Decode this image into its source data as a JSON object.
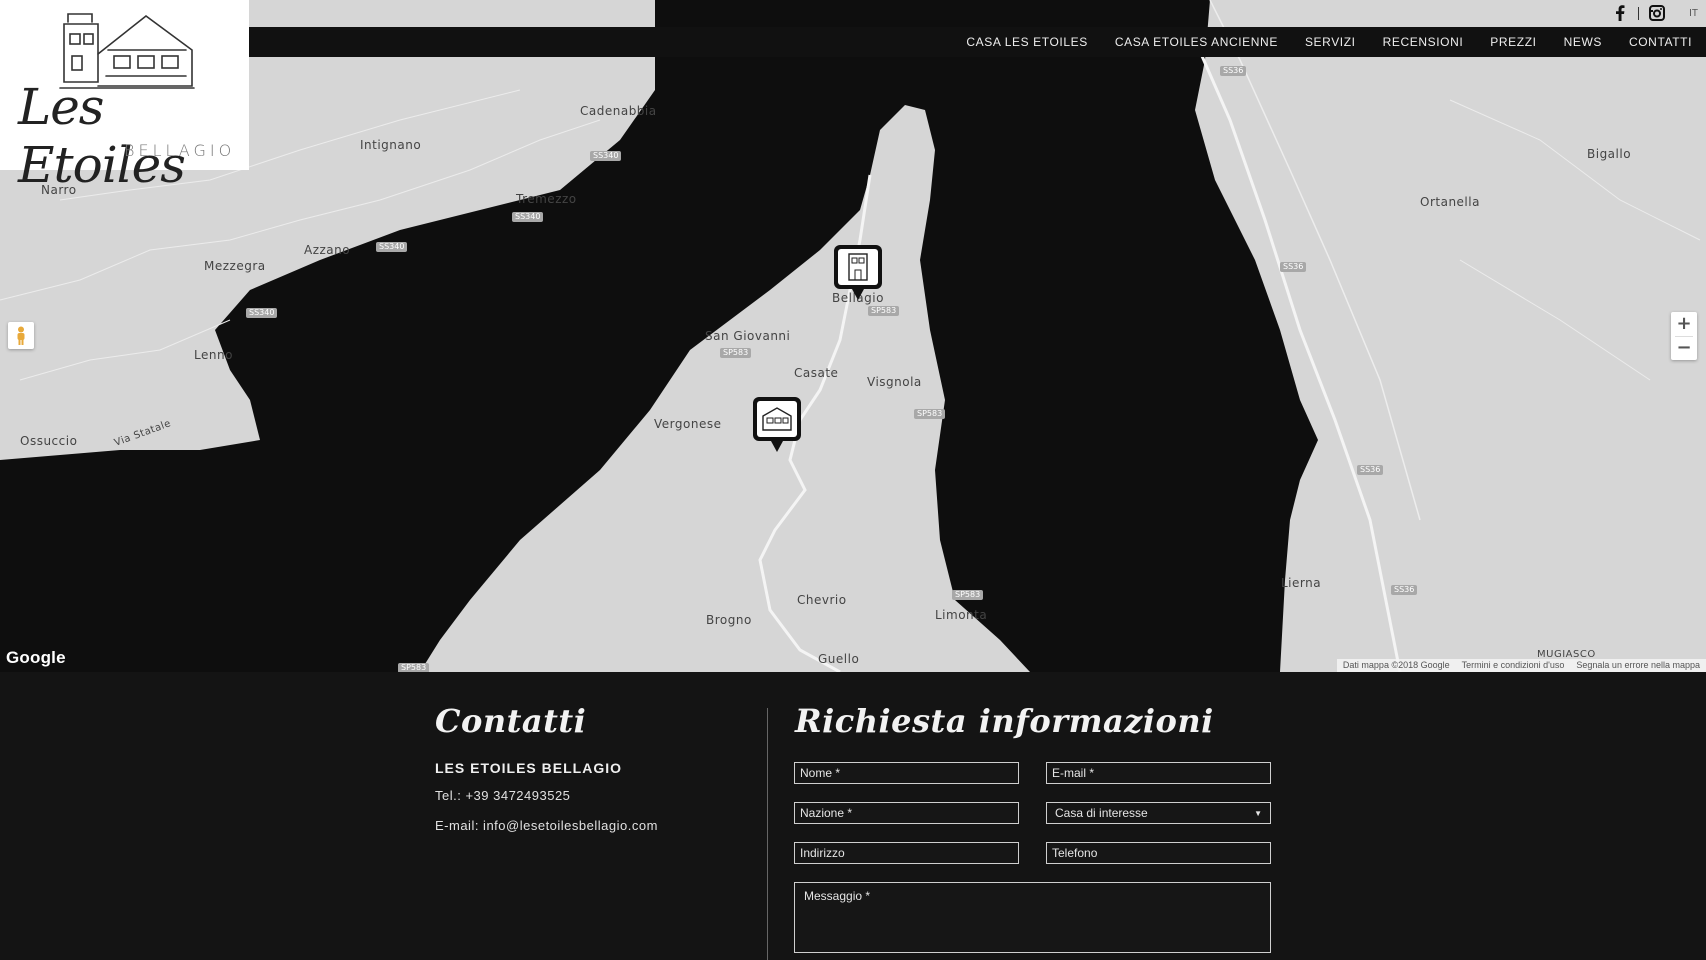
{
  "logo": {
    "script": "Les Etoiles",
    "subtitle": "BELLAGIO"
  },
  "nav": {
    "items": [
      {
        "label": "CASA LES ETOILES"
      },
      {
        "label": "CASA ETOILES ANCIENNE"
      },
      {
        "label": "SERVIZI"
      },
      {
        "label": "RECENSIONI"
      },
      {
        "label": "PREZZI"
      },
      {
        "label": "NEWS"
      },
      {
        "label": "CONTATTI"
      }
    ]
  },
  "social": {
    "facebook_icon": "facebook-icon",
    "instagram_icon": "instagram-icon",
    "language": "IT"
  },
  "map": {
    "places": [
      {
        "name": "Cadenabbia"
      },
      {
        "name": "Intignano"
      },
      {
        "name": "Narro"
      },
      {
        "name": "Tremezzo"
      },
      {
        "name": "Mezzegra"
      },
      {
        "name": "Azzano"
      },
      {
        "name": "Lenno"
      },
      {
        "name": "Ossuccio"
      },
      {
        "name": "Via Statale"
      },
      {
        "name": "Bellagio"
      },
      {
        "name": "San Giovanni"
      },
      {
        "name": "Casate"
      },
      {
        "name": "Visgnola"
      },
      {
        "name": "Vergonese"
      },
      {
        "name": "Chevrio"
      },
      {
        "name": "Brogno"
      },
      {
        "name": "Limonta"
      },
      {
        "name": "Guello"
      },
      {
        "name": "Bigallo"
      },
      {
        "name": "Ortanella"
      },
      {
        "name": "Lierna"
      },
      {
        "name": "MUGIASCO"
      }
    ],
    "roads": [
      "SS340",
      "SS340",
      "SS340",
      "SS340",
      "SP583",
      "SP583",
      "SP583",
      "SP583",
      "SS36",
      "SS36",
      "SS36",
      "SS36",
      "SP583"
    ],
    "google_logo": "Google",
    "attribution": [
      "Dati mappa ©2018 Google",
      "Termini e condizioni d'uso",
      "Segnala un errore nella mappa"
    ],
    "zoom_in": "+",
    "zoom_out": "−"
  },
  "contact": {
    "title": "Contatti",
    "company": "LES ETOILES BELLAGIO",
    "phone": "Tel.: +39 3472493525",
    "email": "E-mail: info@lesetoilesbellagio.com"
  },
  "form": {
    "title": "Richiesta informazioni",
    "name_placeholder": "Nome *",
    "email_placeholder": "E-mail *",
    "country_placeholder": "Nazione *",
    "house_select": "Casa di interesse",
    "address_placeholder": "Indirizzo",
    "phone_placeholder": "Telefono",
    "message_placeholder": "Messaggio *"
  }
}
